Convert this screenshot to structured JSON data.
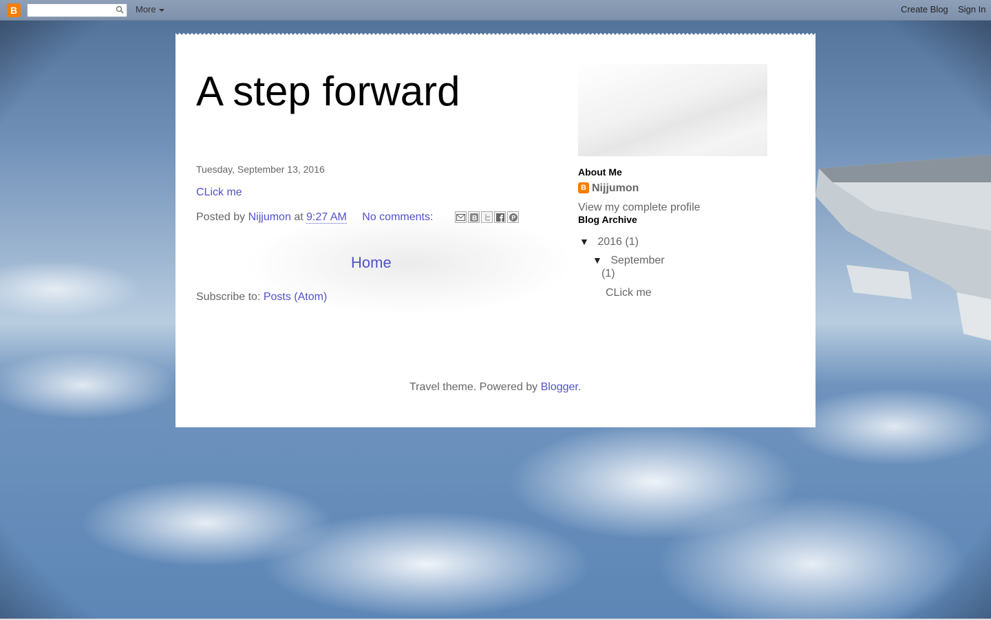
{
  "navbar": {
    "logo": "B",
    "search_placeholder": "",
    "more_label": "More",
    "create_blog_label": "Create Blog",
    "sign_in_label": "Sign In"
  },
  "header": {
    "title": "A step forward"
  },
  "post": {
    "date": "Tuesday, September 13, 2016",
    "title": "CLick me",
    "posted_by_prefix": "Posted by",
    "author": "Nijjumon",
    "at_label": "at",
    "time": "9:27 AM",
    "comments": "No comments:",
    "share_icons": [
      "email-icon",
      "blogthis-icon",
      "twitter-icon",
      "facebook-icon",
      "pinterest-icon"
    ]
  },
  "home_link": "Home",
  "subscribe": {
    "prefix": "Subscribe to:",
    "link": "Posts (Atom)"
  },
  "sidebar": {
    "about_heading": "About Me",
    "profile_name": "Nijjumon",
    "view_profile": "View my complete profile",
    "archive_heading": "Blog Archive",
    "archive": {
      "year": "2016",
      "year_count": "(1)",
      "month": "September",
      "month_count": "(1)",
      "post": "CLick me",
      "toggle": "▼"
    }
  },
  "footer": {
    "text": "Travel theme. Powered by",
    "link": "Blogger",
    "period": "."
  },
  "colors": {
    "link": "#5151c8",
    "text": "#666666",
    "blogger_orange": "#f57d00"
  }
}
